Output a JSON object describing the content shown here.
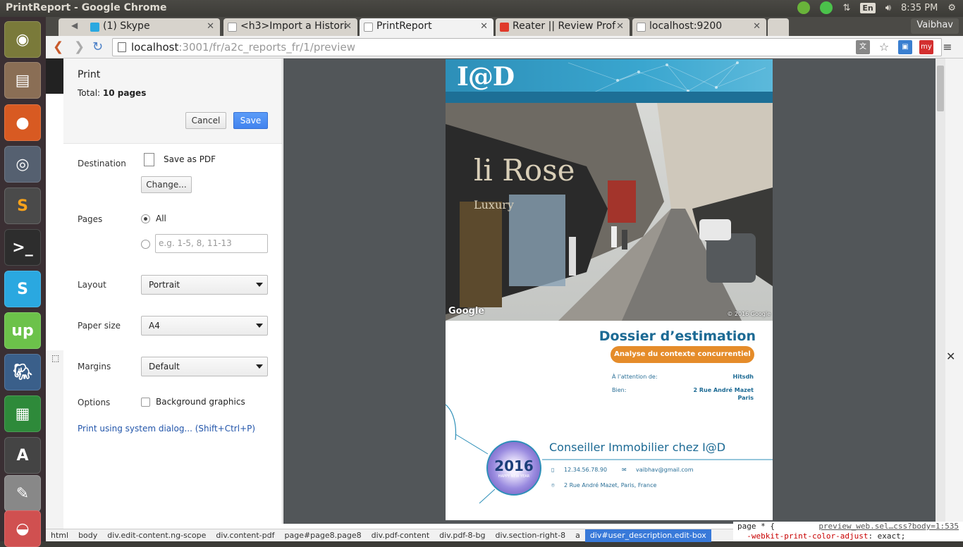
{
  "os_panel": {
    "window_title": "PrintReport - Google Chrome",
    "lang": "En",
    "time": "8:35 PM",
    "user": "Vaibhav"
  },
  "tabs": [
    {
      "label": "(1) Skype",
      "favicon": "skype-icon",
      "color": "#2aa8e0"
    },
    {
      "label": "<h3>Import a Histori",
      "favicon": "page-icon",
      "color": "#999999"
    },
    {
      "label": "PrintReport",
      "favicon": "page-icon",
      "color": "#999999",
      "active": true
    },
    {
      "label": "Reater || Review Prof",
      "favicon": "reater-icon",
      "color": "#e03a2a"
    },
    {
      "label": "localhost:9200",
      "favicon": "page-icon",
      "color": "#999999"
    }
  ],
  "address": {
    "host": "localhost",
    "path": ":3001/fr/a2c_reports_fr/1/preview"
  },
  "print": {
    "title": "Print",
    "total_label": "Total:",
    "total_value": "10 pages",
    "cancel": "Cancel",
    "save": "Save",
    "destination_label": "Destination",
    "destination_value": "Save as PDF",
    "change": "Change...",
    "pages_label": "Pages",
    "pages_all": "All",
    "pages_placeholder": "e.g. 1-5, 8, 11-13",
    "layout_label": "Layout",
    "layout_value": "Portrait",
    "paper_label": "Paper size",
    "paper_value": "A4",
    "margins_label": "Margins",
    "margins_value": "Default",
    "options_label": "Options",
    "background_graphics": "Background graphics",
    "system_dialog": "Print using system dialog... (Shift+Ctrl+P)"
  },
  "preview": {
    "logo": "I@D",
    "google": "Google",
    "copyright": "© 2016 Google",
    "title": "Dossier d’estimation",
    "pill": "Analyse du contexte concurrentiel",
    "attention_label": "À l’attention de:",
    "attention_value": "Hitsdh",
    "bien_label": "Bien:",
    "bien_line1": "2 Rue André Mazet",
    "bien_line2": "Paris",
    "conseiller": "Conseiller Immobilier chez I@D",
    "phone": "12.34.56.78.90",
    "email": "vaibhav@gmail.com",
    "address": "2 Rue André Mazet, Paris, France",
    "badge_year": "2016",
    "badge_sub": "HAPPY NEW YEAR"
  },
  "breadcrumbs": [
    "html",
    "body",
    "div.edit-content.ng-scope",
    "div.content-pdf",
    "page#page8.page8",
    "div.pdf-content",
    "div.pdf-8-bg",
    "div.section-right-8",
    "a",
    "div#user_description.edit-box"
  ],
  "css_pane": {
    "selector": "page * {",
    "source": "preview_web.sel…css?body=1:535",
    "rule_prop": "-webkit-print-color-adjust",
    "rule_val": ": exact;"
  }
}
